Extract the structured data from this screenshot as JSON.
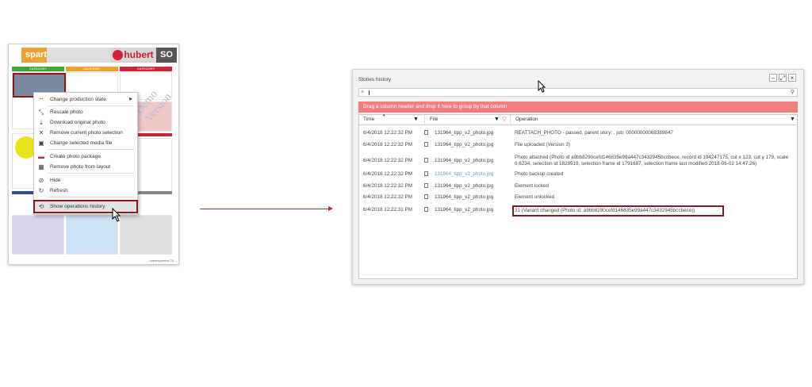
{
  "layout_page": {
    "brand_left": "sparte",
    "brand_right": "hubert",
    "brand_code": "SO",
    "category_label": "CATEGORY",
    "footer": "hubersystems 23",
    "watermark": "Demo Version",
    "colors": {
      "orange": "#f0a030",
      "green": "#3fa535",
      "red": "#c8283c",
      "blue": "#2b4aa0",
      "gray": "#888888"
    }
  },
  "context_menu": {
    "items": [
      {
        "icon": "move-icon",
        "label": "Change production state",
        "has_submenu": true
      },
      {
        "icon": "rescale-icon",
        "label": "Rescale photo"
      },
      {
        "icon": "download-icon",
        "label": "Download original photo"
      },
      {
        "icon": "close-icon",
        "label": "Remove current photo selection"
      },
      {
        "icon": "media-icon",
        "label": "Change selected media file"
      },
      {
        "icon": "package-icon",
        "label": "Create photo package"
      },
      {
        "icon": "layout-icon",
        "label": "Remove photo from layout"
      },
      {
        "icon": "hide-icon",
        "label": "Hide"
      },
      {
        "icon": "refresh-icon",
        "label": "Refresh"
      },
      {
        "icon": "history-icon",
        "label": "Show operations history"
      }
    ]
  },
  "stories_window": {
    "title": "Stories history",
    "search_value": "",
    "group_banner": "Drag a column header and drop it here to group by that column",
    "columns": {
      "time": "Time",
      "file": "File",
      "operation": "Operation"
    },
    "rows": [
      {
        "time": "6/4/2018 12:22:32 PM",
        "file": "131964_tipp_v2_photo.jpg",
        "operation": "REATTACH_PHOTO - passed, parent story: , job: 00000000068389847"
      },
      {
        "time": "6/4/2018 12:22:32 PM",
        "file": "131964_tipp_v2_photo.jpg",
        "operation": "File uploaded (Version 3)"
      },
      {
        "time": "6/4/2018 12:22:32 PM",
        "file": "131964_tipp_v2_photo.jpg",
        "operation": "Photo attached (Photo id a9bb8290cefd146835e99a447c3432945bccbece, record id 194247175, cut x 123, cut y 179, scale 0,6234, selection id 1829519, selection frame id 1791687, selection frame last modified 2018-06-02 14:47:26)"
      },
      {
        "time": "6/4/2018 12:22:32 PM",
        "file": "131964_tipp_v2_photo.jpg",
        "operation": "Photo backup created",
        "file_link": true
      },
      {
        "time": "6/4/2018 12:22:32 PM",
        "file": "131964_tipp_v2_photo.jpg",
        "operation": "Element locked"
      },
      {
        "time": "6/4/2018 12:22:32 PM",
        "file": "131964_tipp_v2_photo.jpg",
        "operation": "Element unlocked"
      },
      {
        "time": "6/4/2018 12:22:31 PM",
        "file": "131964_tipp_v2_photo.jpg",
        "operation": "31 (Variant changed (Photo id: a9bb8290cefd146835e99a447c3432945bccbece))",
        "highlighted": true
      }
    ]
  }
}
